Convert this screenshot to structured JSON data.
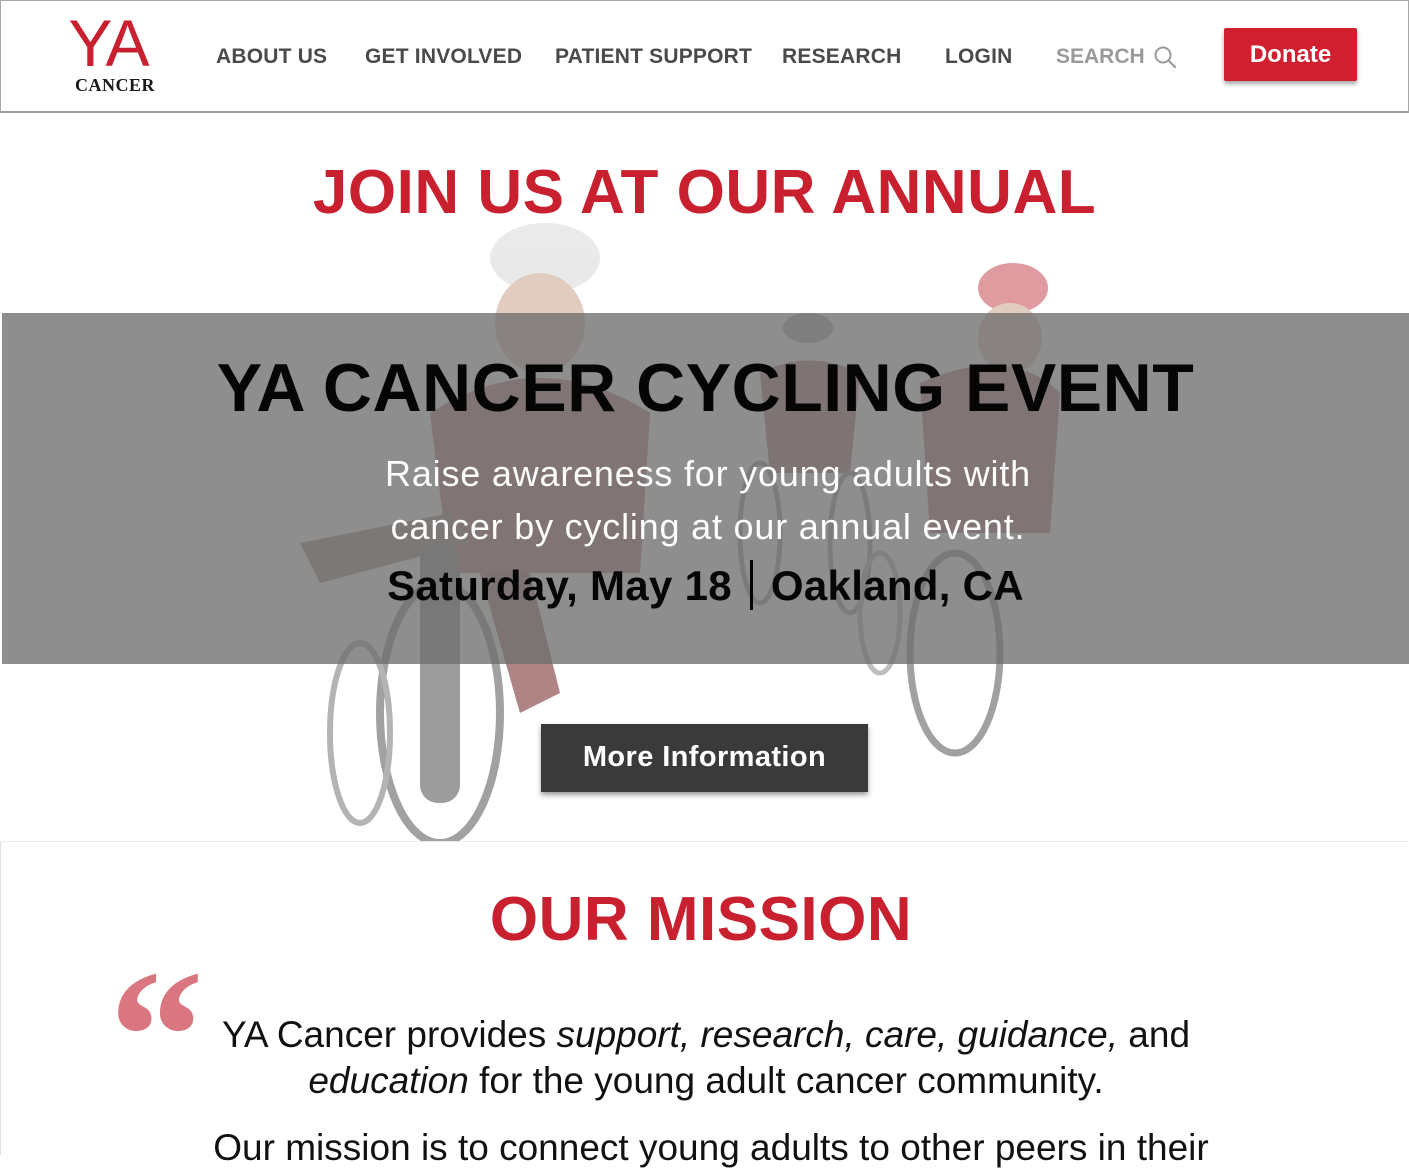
{
  "header": {
    "logo": {
      "mark": "YA",
      "sub": "CANCER"
    },
    "nav": [
      {
        "label": "ABOUT US"
      },
      {
        "label": "GET INVOLVED"
      },
      {
        "label": "PATIENT SUPPORT"
      },
      {
        "label": "RESEARCH"
      },
      {
        "label": "LOGIN"
      }
    ],
    "search": {
      "label": "SEARCH",
      "icon": "search-icon"
    },
    "donate_label": "Donate"
  },
  "hero": {
    "title": "JOIN US AT OUR ANNUAL",
    "event_title": "YA CANCER CYCLING EVENT",
    "description": "Raise awareness for young adults with cancer by cycling at our annual event.",
    "date": "Saturday, May 18",
    "location": "Oakland, CA",
    "button_label": "More Information"
  },
  "mission": {
    "title": "OUR MISSION",
    "quote_glyph": "“",
    "org_name": "YA Cancer",
    "provides": " provides ",
    "items": "support, research, care, guidance,",
    "and": " and",
    "education": "education",
    "rest": " for the young adult cancer community.",
    "line2_lead": "Our mission",
    "line2_rest": " is to connect young adults to other peers in their"
  },
  "colors": {
    "brand_red": "#c8202f",
    "donate_red": "#d0202f",
    "button_dark": "#3a3a3a",
    "nav_text": "#4a4a4a",
    "quote_pink": "#d97680"
  }
}
